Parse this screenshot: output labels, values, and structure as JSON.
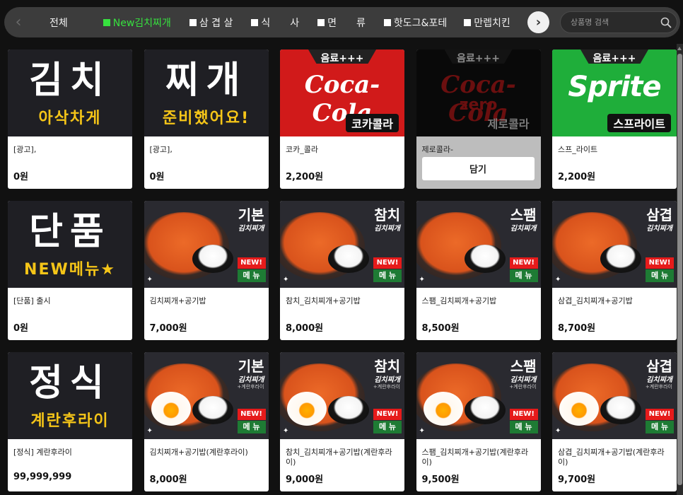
{
  "nav": {
    "items": [
      {
        "label": "전체",
        "active": false,
        "square": false
      },
      {
        "label": "New김치찌개",
        "active": true,
        "square": true
      },
      {
        "label": "삼 겹 살",
        "active": false,
        "square": true
      },
      {
        "label": "식　　사",
        "active": false,
        "square": true
      },
      {
        "label": "면　　류",
        "active": false,
        "square": true
      },
      {
        "label": "핫도그&포테",
        "active": false,
        "square": true
      },
      {
        "label": "만렙치킨",
        "active": false,
        "square": true
      }
    ],
    "prev_icon": "chevron-left-icon",
    "next_icon": "chevron-right-icon"
  },
  "search": {
    "placeholder": "상품명 검색",
    "icon": "search-icon"
  },
  "add_button_label": "담기",
  "products": [
    {
      "image": {
        "kind": "promo",
        "big1": "김치",
        "sub": "아삭차게"
      },
      "name": "[광고],",
      "price": "0원"
    },
    {
      "image": {
        "kind": "promo",
        "big1": "찌개",
        "sub": "준비했어요!"
      },
      "name": "[광고],",
      "price": "0원"
    },
    {
      "image": {
        "kind": "drink",
        "variant": "coke",
        "tag": "음료+++",
        "logo": "Coca-Cola",
        "kor": "코카콜라"
      },
      "name": "코카_콜라",
      "price": "2,200원"
    },
    {
      "image": {
        "kind": "drink",
        "variant": "zero",
        "tag": "음료+++",
        "logo": "Coca-Cola",
        "extra": "zero",
        "kor": "제로콜라"
      },
      "name": "제로콜라-",
      "price": "",
      "dim": true
    },
    {
      "image": {
        "kind": "drink",
        "variant": "sprite",
        "tag": "음료+++",
        "logo": "Sprite",
        "kor": "스프라이트"
      },
      "name": "스프_라이트",
      "price": "2,200원"
    },
    {
      "image": {
        "kind": "promo",
        "big1": "단품",
        "sub": "NEW메뉴★"
      },
      "name": "[단품] 출시",
      "price": "0원"
    },
    {
      "image": {
        "kind": "stew",
        "t1": "기본",
        "t2": "김치찌개",
        "new": "NEW!",
        "menu": "메 뉴"
      },
      "name": "김치찌개+공기밥",
      "price": "7,000원"
    },
    {
      "image": {
        "kind": "stew",
        "t1": "참치",
        "t2": "김치찌개",
        "new": "NEW!",
        "menu": "메 뉴"
      },
      "name": "참치_김치찌개+공기밥",
      "price": "8,000원"
    },
    {
      "image": {
        "kind": "stew",
        "t1": "스팸",
        "t2": "김치찌개",
        "new": "NEW!",
        "menu": "메 뉴"
      },
      "name": "스팸_김치찌개+공기밥",
      "price": "8,500원"
    },
    {
      "image": {
        "kind": "stew",
        "t1": "삼겹",
        "t2": "김치찌개",
        "new": "NEW!",
        "menu": "메 뉴"
      },
      "name": "삼겹_김치찌개+공기밥",
      "price": "8,700원"
    },
    {
      "image": {
        "kind": "promo",
        "big1": "정식",
        "sub": "계란후라이"
      },
      "name": "[정식] 계란후라이",
      "price": "99,999,999"
    },
    {
      "image": {
        "kind": "stew",
        "egg": true,
        "t1": "기본",
        "t2": "김치찌개",
        "t3": "+계란후라이",
        "new": "NEW!",
        "menu": "메 뉴"
      },
      "name": "김치찌개+공기밥(계란후라이)",
      "price": "8,000원"
    },
    {
      "image": {
        "kind": "stew",
        "egg": true,
        "t1": "참치",
        "t2": "김치찌개",
        "t3": "+계란후라이",
        "new": "NEW!",
        "menu": "메 뉴"
      },
      "name": "참치_김치찌개+공기밥(계란후라이)",
      "price": "9,000원"
    },
    {
      "image": {
        "kind": "stew",
        "egg": true,
        "t1": "스팸",
        "t2": "김치찌개",
        "t3": "+계란후라이",
        "new": "NEW!",
        "menu": "메 뉴"
      },
      "name": "스팸_김치찌개+공기밥(계란후라이)",
      "price": "9,500원"
    },
    {
      "image": {
        "kind": "stew",
        "egg": true,
        "t1": "삼겹",
        "t2": "김치찌개",
        "t3": "+계란후라이",
        "new": "NEW!",
        "menu": "메 뉴"
      },
      "name": "삼겹_김치찌개+공기밥(계란후라이)",
      "price": "9,700원"
    }
  ],
  "colors": {
    "active_category": "#37e13f",
    "background": "#111111",
    "navbar": "#3c3c3c"
  }
}
